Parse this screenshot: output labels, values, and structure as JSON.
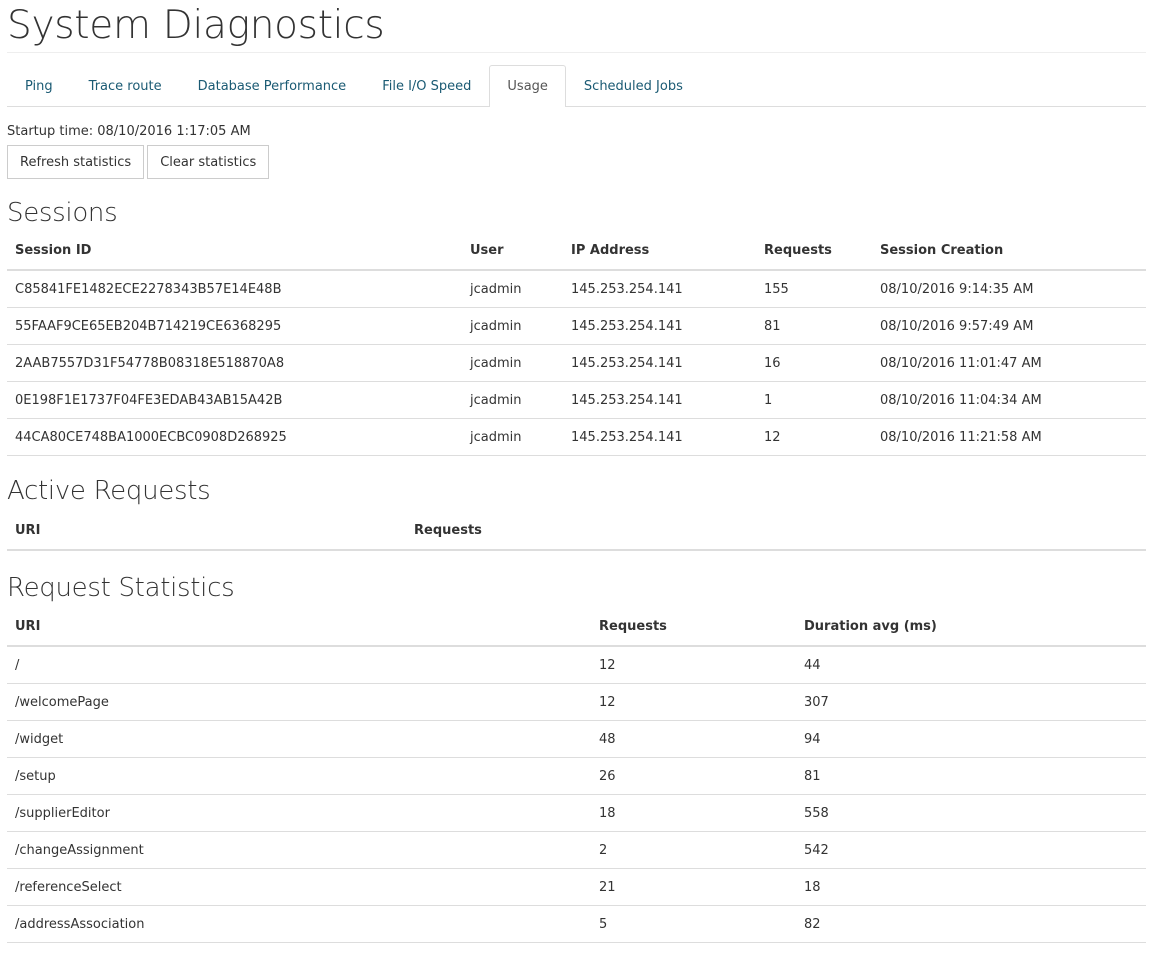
{
  "page": {
    "title": "System Diagnostics"
  },
  "tabs": [
    {
      "label": "Ping",
      "active": false
    },
    {
      "label": "Trace route",
      "active": false
    },
    {
      "label": "Database Performance",
      "active": false
    },
    {
      "label": "File I/O Speed",
      "active": false
    },
    {
      "label": "Usage",
      "active": true
    },
    {
      "label": "Scheduled Jobs",
      "active": false
    }
  ],
  "usage": {
    "startup_label": "Startup time: 08/10/2016 1:17:05 AM",
    "refresh_label": "Refresh statistics",
    "clear_label": "Clear statistics"
  },
  "sessions": {
    "title": "Sessions",
    "headers": [
      "Session ID",
      "User",
      "IP Address",
      "Requests",
      "Session Creation"
    ],
    "rows": [
      [
        "C85841FE1482ECE2278343B57E14E48B",
        "jcadmin",
        "145.253.254.141",
        "155",
        "08/10/2016 9:14:35 AM"
      ],
      [
        "55FAAF9CE65EB204B714219CE6368295",
        "jcadmin",
        "145.253.254.141",
        "81",
        "08/10/2016 9:57:49 AM"
      ],
      [
        "2AAB7557D31F54778B08318E518870A8",
        "jcadmin",
        "145.253.254.141",
        "16",
        "08/10/2016 11:01:47 AM"
      ],
      [
        "0E198F1E1737F04FE3EDAB43AB15A42B",
        "jcadmin",
        "145.253.254.141",
        "1",
        "08/10/2016 11:04:34 AM"
      ],
      [
        "44CA80CE748BA1000ECBC0908D268925",
        "jcadmin",
        "145.253.254.141",
        "12",
        "08/10/2016 11:21:58 AM"
      ]
    ]
  },
  "active_requests": {
    "title": "Active Requests",
    "headers": [
      "URI",
      "Requests"
    ]
  },
  "request_statistics": {
    "title": "Request Statistics",
    "headers": [
      "URI",
      "Requests",
      "Duration avg (ms)"
    ],
    "rows": [
      [
        "/",
        "12",
        "44"
      ],
      [
        "/welcomePage",
        "12",
        "307"
      ],
      [
        "/widget",
        "48",
        "94"
      ],
      [
        "/setup",
        "26",
        "81"
      ],
      [
        "/supplierEditor",
        "18",
        "558"
      ],
      [
        "/changeAssignment",
        "2",
        "542"
      ],
      [
        "/referenceSelect",
        "21",
        "18"
      ],
      [
        "/addressAssociation",
        "5",
        "82"
      ]
    ]
  }
}
